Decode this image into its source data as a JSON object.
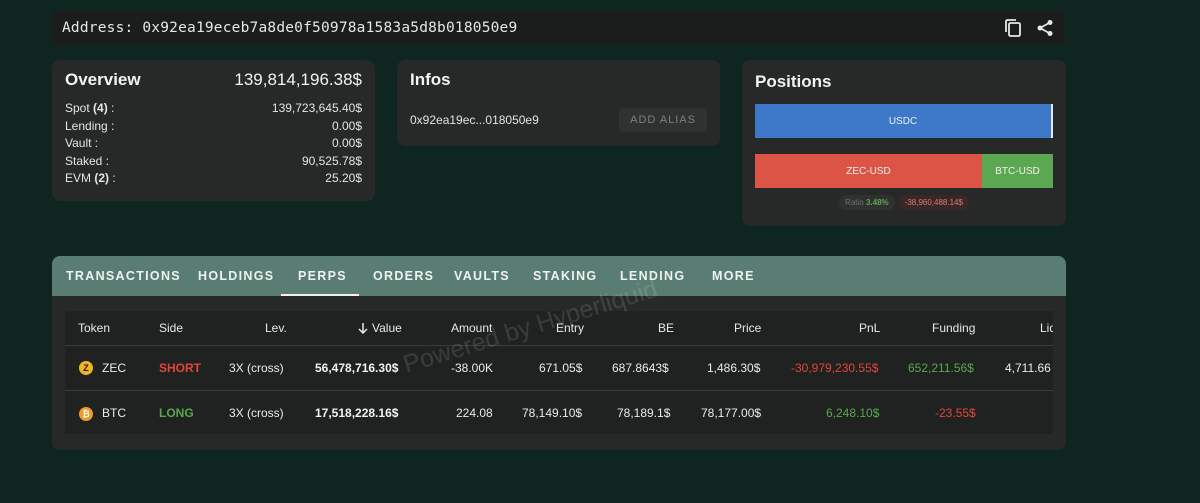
{
  "address": {
    "label": "Address: 0x92ea19eceb7a8de0f50978a1583a5d8b018050e9"
  },
  "overview": {
    "title": "Overview",
    "total": "139,814,196.38$",
    "rows": [
      {
        "label": "Spot ",
        "count": "(4)",
        "suffix": " :",
        "value": "139,723,645.40$"
      },
      {
        "label": "Lending :",
        "count": "",
        "suffix": "",
        "value": "0.00$"
      },
      {
        "label": "Vault :",
        "count": "",
        "suffix": "",
        "value": "0.00$"
      },
      {
        "label": "Staked :",
        "count": "",
        "suffix": "",
        "value": "90,525.78$"
      },
      {
        "label": "EVM ",
        "count": "(2)",
        "suffix": " :",
        "value": "25.20$"
      }
    ]
  },
  "infos": {
    "title": "Infos",
    "short_address": "0x92ea19ec...018050e9",
    "alias_button": "ADD ALIAS"
  },
  "positions": {
    "title": "Positions",
    "usdc_label": "USDC",
    "zec_label": "ZEC-USD",
    "btc_label": "BTC-USD",
    "ratio_label": "Ratio",
    "ratio_value": "3.48%",
    "net_value": "-38,960,488.14$"
  },
  "tabs": [
    "TRANSACTIONS",
    "HOLDINGS",
    "PERPS",
    "ORDERS",
    "VAULTS",
    "STAKING",
    "LENDING",
    "MORE"
  ],
  "active_tab": "PERPS",
  "table": {
    "headers": {
      "token": "Token",
      "side": "Side",
      "lev": "Lev.",
      "value": "Value",
      "amount": "Amount",
      "entry": "Entry",
      "be": "BE",
      "price": "Price",
      "pnl": "PnL",
      "funding": "Funding",
      "liq": "Liq"
    },
    "rows": [
      {
        "token": "ZEC",
        "token_icon": "zcash-icon",
        "side": "SHORT",
        "lev": "3X (cross)",
        "value": "56,478,716.30$",
        "amount": "-38.00K",
        "entry": "671.05$",
        "be": "687.8643$",
        "price": "1,486.30$",
        "pnl": "-30,979,230.55$",
        "funding": "652,211.56$",
        "liq": "4,711.66"
      },
      {
        "token": "BTC",
        "token_icon": "bitcoin-icon",
        "side": "LONG",
        "lev": "3X (cross)",
        "value": "17,518,228.16$",
        "amount": "224.08",
        "entry": "78,149.10$",
        "be": "78,189.1$",
        "price": "78,177.00$",
        "pnl": "6,248.10$",
        "funding": "-23.55$",
        "liq": ""
      }
    ]
  },
  "watermark": "Powered by Hyperliquid",
  "colors": {
    "background": "#0f2620",
    "tabbar": "#5a7d73",
    "usdc": "#3e78c9",
    "short": "#e3453a",
    "long": "#58a84b"
  }
}
